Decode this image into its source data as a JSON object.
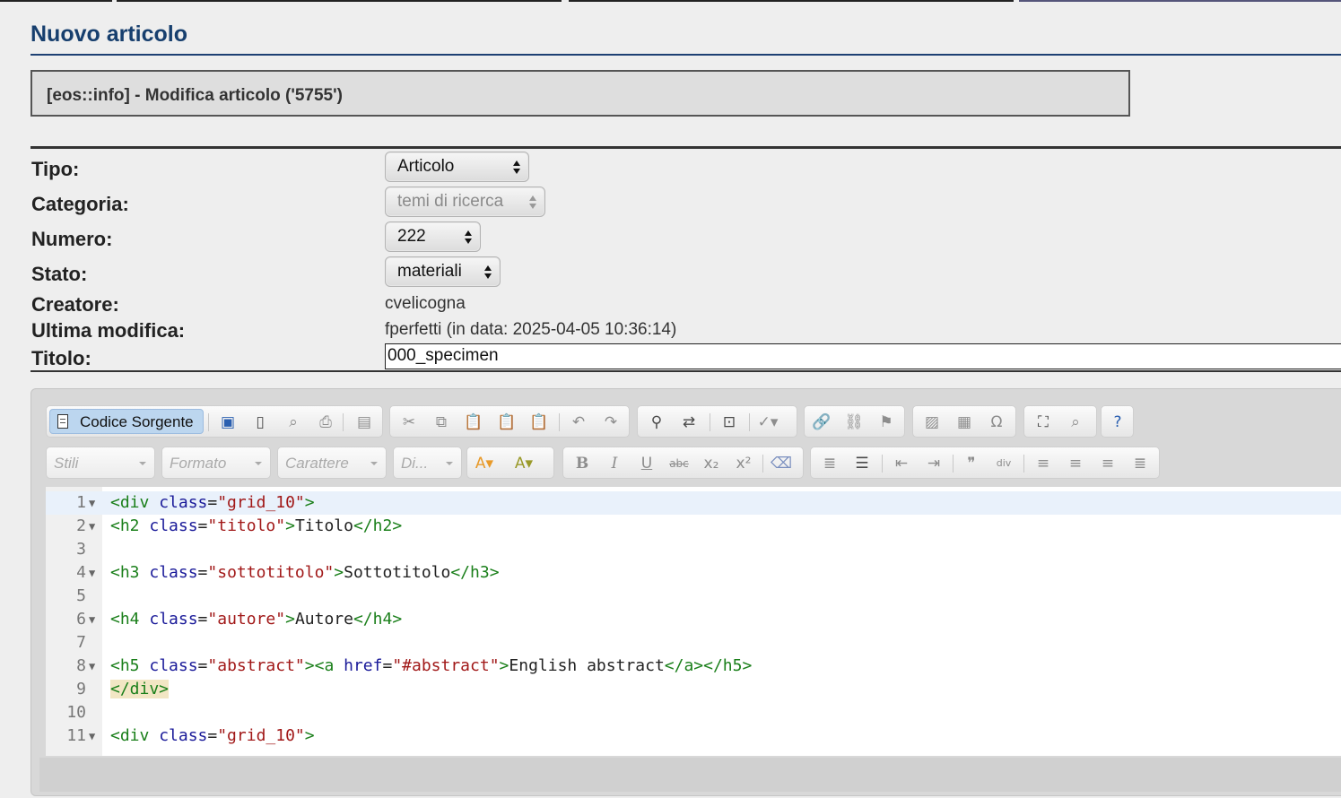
{
  "page": {
    "title": "Nuovo articolo",
    "info": "[eos::info] - Modifica articolo ('5755')"
  },
  "form": {
    "tipo": {
      "label": "Tipo:",
      "value": "Articolo"
    },
    "categoria": {
      "label": "Categoria:",
      "value": "temi di ricerca"
    },
    "numero": {
      "label": "Numero:",
      "value": "222"
    },
    "stato": {
      "label": "Stato:",
      "value": "materiali"
    },
    "creatore": {
      "label": "Creatore:",
      "value": "cvelicogna"
    },
    "ultima_modifica": {
      "label": "Ultima modifica:",
      "value": "fperfetti (in data: 2025-04-05 10:36:14)"
    },
    "titolo": {
      "label": "Titolo:",
      "value": "000_specimen"
    }
  },
  "toolbar": {
    "source_label": "Codice Sorgente",
    "combos": {
      "styles": "Stili",
      "format": "Formato",
      "font": "Carattere",
      "size": "Di..."
    },
    "icons": [
      "save-icon",
      "new-page-icon",
      "preview-icon",
      "print-icon",
      "templates-icon",
      "cut-icon",
      "copy-icon",
      "paste-icon",
      "paste-text-icon",
      "paste-word-icon",
      "undo-icon",
      "redo-icon",
      "find-icon",
      "replace-icon",
      "select-all-icon",
      "spellcheck-icon",
      "link-icon",
      "unlink-icon",
      "anchor-icon",
      "image-icon",
      "table-icon",
      "special-char-icon",
      "maximize-icon",
      "show-blocks-icon",
      "help-icon",
      "text-color-icon",
      "bg-color-icon",
      "bold-icon",
      "italic-icon",
      "underline-icon",
      "strike-icon",
      "subscript-icon",
      "superscript-icon",
      "remove-format-icon",
      "numbered-list-icon",
      "bulleted-list-icon",
      "outdent-icon",
      "indent-icon",
      "blockquote-icon",
      "div-icon",
      "align-left-icon",
      "align-center-icon",
      "align-right-icon",
      "justify-icon"
    ]
  },
  "code_lines": [
    {
      "n": "1",
      "fold": true,
      "html": "<span class=\"tg\">&lt;div </span><span class=\"at\">class</span>=<span class=\"vl\">\"grid_10\"</span><span class=\"tg\">&gt;</span>"
    },
    {
      "n": "2",
      "fold": true,
      "html": "<span class=\"tg\">&lt;h2 </span><span class=\"at\">class</span>=<span class=\"vl\">\"titolo\"</span><span class=\"tg\">&gt;</span>Titolo<span class=\"tg\">&lt;/h2&gt;</span>"
    },
    {
      "n": "3",
      "fold": false,
      "html": ""
    },
    {
      "n": "4",
      "fold": true,
      "html": "<span class=\"tg\">&lt;h3 </span><span class=\"at\">class</span>=<span class=\"vl\">\"sottotitolo\"</span><span class=\"tg\">&gt;</span>Sottotitolo<span class=\"tg\">&lt;/h3&gt;</span>"
    },
    {
      "n": "5",
      "fold": false,
      "html": ""
    },
    {
      "n": "6",
      "fold": true,
      "html": "<span class=\"tg\">&lt;h4 </span><span class=\"at\">class</span>=<span class=\"vl\">\"autore\"</span><span class=\"tg\">&gt;</span>Autore<span class=\"tg\">&lt;/h4&gt;</span>"
    },
    {
      "n": "7",
      "fold": false,
      "html": ""
    },
    {
      "n": "8",
      "fold": true,
      "html": "<span class=\"tg\">&lt;h5 </span><span class=\"at\">class</span>=<span class=\"vl\">\"abstract\"</span><span class=\"tg\">&gt;&lt;a </span><span class=\"at\">href</span>=<span class=\"vl\">\"#abstract\"</span><span class=\"tg\">&gt;</span>English abstract<span class=\"tg\">&lt;/a&gt;&lt;/h5&gt;</span>"
    },
    {
      "n": "9",
      "fold": false,
      "html": "<span class=\"tg hl\">&lt;/div&gt;</span>"
    },
    {
      "n": "10",
      "fold": false,
      "html": ""
    },
    {
      "n": "11",
      "fold": true,
      "html": "<span class=\"tg\">&lt;div </span><span class=\"at\">class</span>=<span class=\"vl\">\"grid_10\"</span><span class=\"tg\">&gt;</span>"
    }
  ]
}
